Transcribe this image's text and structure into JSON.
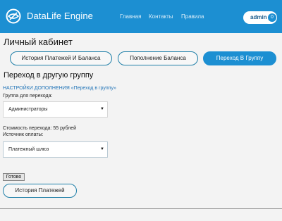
{
  "header": {
    "app_title": "DataLife Engine",
    "nav": {
      "main": "Главная",
      "contacts": "Контакты",
      "rules": "Правила"
    },
    "user": {
      "name": "admin",
      "badge_count": "0"
    },
    "accent_color": "#1c8fd2"
  },
  "page": {
    "title": "Личный кабинет",
    "tabs": {
      "history_balance": "История Платежей И Баланса",
      "topup": "Пополнение Баланса",
      "transfer": "Переход В Группу"
    },
    "section_title": "Переход в другую группу",
    "settings_link": "НАСТРОЙКИ ДОПОЛНЕНИЯ «Переход в группу»",
    "group_label": "Группа для перехода:",
    "group_value": "Администраторы",
    "cost_text": "Стоимость перехода: 55 рублей",
    "source_label": "Источник оплаты:",
    "source_value": "Платежный шлюз",
    "submit_label": "Готово",
    "history_button": "История Платежей"
  }
}
